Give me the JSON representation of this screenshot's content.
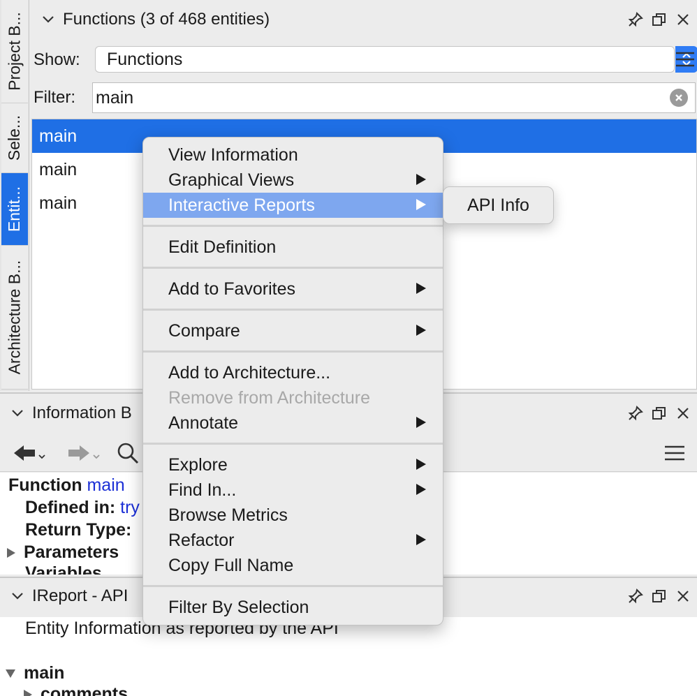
{
  "vertical_tabs": [
    {
      "label": "Project B...",
      "active": false
    },
    {
      "label": "Sele...",
      "active": false
    },
    {
      "label": "Entit...",
      "active": true
    },
    {
      "label": "Architecture B...",
      "active": false
    }
  ],
  "entity_panel": {
    "title": "Functions (3 of 468 entities)",
    "show_label": "Show:",
    "show_value": "Functions",
    "filter_label": "Filter:",
    "filter_value": "main",
    "items": [
      "main",
      "main",
      "main"
    ]
  },
  "info_panel": {
    "title": "Information B",
    "function_keyword": "Function",
    "function_name": "main",
    "defined_in_label": "Defined in:",
    "defined_in_value": "try",
    "return_type_label": "Return Type:",
    "parameters_label": "Parameters",
    "variables_label": "Variables"
  },
  "ireport_panel": {
    "title": "IReport - API",
    "description": "Entity Information as reported by the API",
    "tree_root": "main",
    "tree_child": "comments"
  },
  "context_menu": {
    "groups": [
      [
        {
          "label": "View Information",
          "submenu": false
        },
        {
          "label": "Graphical Views",
          "submenu": true
        },
        {
          "label": "Interactive Reports",
          "submenu": true,
          "highlighted": true
        }
      ],
      [
        {
          "label": "Edit Definition",
          "submenu": false
        }
      ],
      [
        {
          "label": "Add to Favorites",
          "submenu": true
        }
      ],
      [
        {
          "label": "Compare",
          "submenu": true
        }
      ],
      [
        {
          "label": "Add to Architecture...",
          "submenu": false
        },
        {
          "label": "Remove from Architecture",
          "submenu": false,
          "disabled": true
        },
        {
          "label": "Annotate",
          "submenu": true
        }
      ],
      [
        {
          "label": "Explore",
          "submenu": true
        },
        {
          "label": "Find In...",
          "submenu": true
        },
        {
          "label": "Browse Metrics",
          "submenu": false
        },
        {
          "label": "Refactor",
          "submenu": true
        },
        {
          "label": "Copy Full Name",
          "submenu": false
        }
      ],
      [
        {
          "label": "Filter By Selection",
          "submenu": false
        }
      ]
    ]
  },
  "submenu": {
    "label": "API Info"
  },
  "colors": {
    "selection_blue": "#1f6fe5",
    "menu_highlight": "#7ea7ef",
    "link_blue": "#1b2fd6"
  }
}
